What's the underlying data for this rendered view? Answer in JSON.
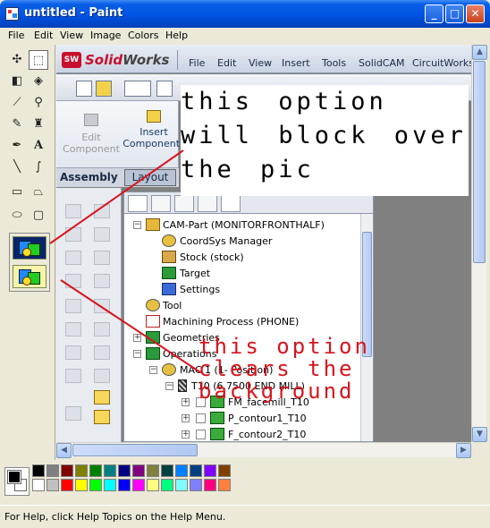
{
  "window": {
    "title": "untitled - Paint",
    "minimize_label": "_",
    "maximize_label": "□",
    "close_label": "✕"
  },
  "menubar": {
    "items": [
      "File",
      "Edit",
      "View",
      "Image",
      "Colors",
      "Help"
    ]
  },
  "toolbox": {
    "tools": [
      {
        "name": "free-form-select",
        "glyph": "✣"
      },
      {
        "name": "rect-select",
        "glyph": "⬚"
      },
      {
        "name": "eraser",
        "glyph": "◧"
      },
      {
        "name": "fill-with-color",
        "glyph": "◈"
      },
      {
        "name": "pick-color",
        "glyph": "⟋"
      },
      {
        "name": "magnifier",
        "glyph": "⚲"
      },
      {
        "name": "pencil",
        "glyph": "✎"
      },
      {
        "name": "brush",
        "glyph": "♜"
      },
      {
        "name": "airbrush",
        "glyph": "✒"
      },
      {
        "name": "text",
        "glyph": "A"
      },
      {
        "name": "line",
        "glyph": "╲"
      },
      {
        "name": "curve",
        "glyph": "∫"
      },
      {
        "name": "rectangle",
        "glyph": "▭"
      },
      {
        "name": "polygon",
        "glyph": "⏢"
      },
      {
        "name": "ellipse",
        "glyph": "⬭"
      },
      {
        "name": "rounded-rectangle",
        "glyph": "▢"
      }
    ],
    "options": {
      "opaque_selected": true
    }
  },
  "solidworks": {
    "logo_ds": "SW",
    "logo_solid": "Solid",
    "logo_works": "Works",
    "menu": [
      "File",
      "Edit",
      "View",
      "Insert",
      "Tools",
      "SolidCAM",
      "CircuitWorks"
    ],
    "command_manager": {
      "edit_component": "Edit\nComponent",
      "insert_components": "Insert\nComponents"
    },
    "tabs": {
      "assembly": "Assembly",
      "layout": "Layout"
    },
    "tree": [
      {
        "label": "CAM-Part (MONITORFRONTHALF)",
        "icon": "cam-part-icon"
      },
      {
        "label": "CoordSys Manager",
        "icon": "coordsys-icon"
      },
      {
        "label": "Stock (stock)",
        "icon": "stock-icon"
      },
      {
        "label": "Target",
        "icon": "target-icon"
      },
      {
        "label": "Settings",
        "icon": "settings-icon"
      },
      {
        "label": "Tool",
        "icon": "tool-icon"
      },
      {
        "label": "Machining Process (PHONE)",
        "icon": "machining-icon"
      },
      {
        "label": "Geometries",
        "icon": "geometry-icon"
      },
      {
        "label": "Operations",
        "icon": "operations-icon"
      },
      {
        "label": "MAC 1 (1- Position)",
        "icon": "mac-icon"
      },
      {
        "label": "T10 (6.7500 END MILL)",
        "icon": "tool-t10-icon"
      },
      {
        "label": "FM_facemill_T10",
        "icon": "facemill-icon"
      },
      {
        "label": "P_contour1_T10",
        "icon": "contour-icon"
      },
      {
        "label": "F_contour2_T10",
        "icon": "contour2-icon"
      }
    ]
  },
  "annotations": {
    "callout_top": "this option will block over the pic",
    "callout_bottom": "this option clears the background"
  },
  "palette": {
    "top_row": [
      "#000000",
      "#808080",
      "#800000",
      "#808000",
      "#008000",
      "#008080",
      "#000080",
      "#800080",
      "#808040",
      "#004040",
      "#0080ff",
      "#004080",
      "#8000ff",
      "#804000"
    ],
    "bottom_row": [
      "#ffffff",
      "#c0c0c0",
      "#ff0000",
      "#ffff00",
      "#00ff00",
      "#00ffff",
      "#0000ff",
      "#ff00ff",
      "#ffff80",
      "#00ff80",
      "#80ffff",
      "#8080ff",
      "#ff0080",
      "#ff8040"
    ]
  },
  "statusbar": {
    "text": "For Help, click Help Topics on the Help Menu."
  },
  "colors": {
    "title_bar": "#0055e5",
    "annotation_red": "#d8141e"
  }
}
